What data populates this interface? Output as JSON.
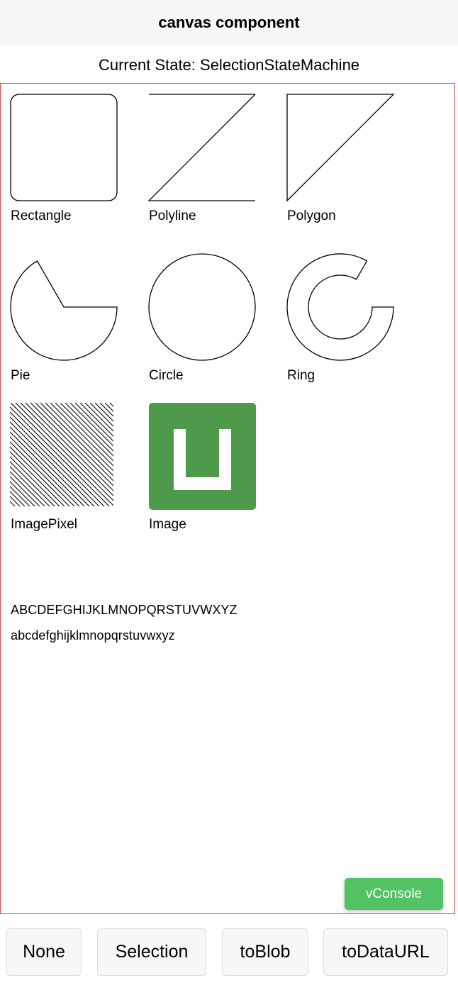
{
  "header": {
    "title": "canvas component"
  },
  "status": {
    "text": "Current State: SelectionStateMachine"
  },
  "shapes": [
    {
      "label": "Rectangle",
      "icon": "rectangle-icon"
    },
    {
      "label": "Polyline",
      "icon": "polyline-icon"
    },
    {
      "label": "Polygon",
      "icon": "polygon-icon"
    },
    {
      "label": "Pie",
      "icon": "pie-icon"
    },
    {
      "label": "Circle",
      "icon": "circle-icon"
    },
    {
      "label": "Ring",
      "icon": "ring-icon"
    },
    {
      "label": "ImagePixel",
      "icon": "hatch-pattern-icon"
    },
    {
      "label": "Image",
      "icon": "image-logo-icon",
      "color": "#4f9a4a"
    }
  ],
  "sample_text": {
    "upper": "ABCDEFGHIJKLMNOPQRSTUVWXYZ",
    "lower": "abcdefghijklmnopqrstuvwxyz"
  },
  "vconsole": {
    "label": "vConsole",
    "color": "#52c264"
  },
  "toolbar": {
    "buttons": [
      "None",
      "Selection",
      "toBlob",
      "toDataURL"
    ]
  },
  "colors": {
    "canvas_border": "#e0474c",
    "header_bg": "#f7f7f7"
  }
}
